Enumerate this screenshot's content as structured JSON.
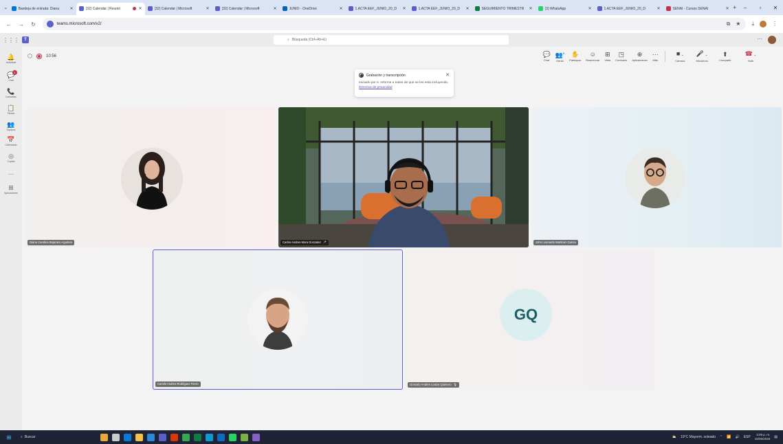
{
  "browser": {
    "tabs": [
      {
        "title": "Bandeja de entrada: Diana",
        "color": "#0078d4"
      },
      {
        "title": "(32) Calendar | Reunió",
        "color": "#5b5fc7",
        "active": true
      },
      {
        "title": "(32) Calendar | Microsoft",
        "color": "#5b5fc7"
      },
      {
        "title": "(32) Calendar | Microsoft",
        "color": "#5b5fc7"
      },
      {
        "title": "JUNIO - OneDrive",
        "color": "#0364b8"
      },
      {
        "title": "1.ACTA EEF_JUNIO_20_D",
        "color": "#5b5fc7"
      },
      {
        "title": "1.ACTA EEF_JUNIO_20_D",
        "color": "#5b5fc7"
      },
      {
        "title": "SEGUIMIENTO TRIMESTR",
        "color": "#107c41"
      },
      {
        "title": "(3) WhatsApp",
        "color": "#25d366"
      },
      {
        "title": "1.ACTA EEF_JUNIO_20_D",
        "color": "#5b5fc7"
      },
      {
        "title": "SENAI - Cursos SENAI",
        "color": "#c4314b"
      }
    ],
    "url": "teams.microsoft.com/v2/"
  },
  "teams": {
    "search_placeholder": "Búsqueda (Ctrl+Alt+E)",
    "rail": [
      {
        "label": "Actividad",
        "icon": "bell-icon",
        "glyph": "🔔"
      },
      {
        "label": "Chat",
        "icon": "chat-icon",
        "glyph": "💬",
        "badge": "1"
      },
      {
        "label": "Llamadas",
        "icon": "phone-icon",
        "glyph": "📞"
      },
      {
        "label": "Tareas",
        "icon": "tasks-icon",
        "glyph": "📋"
      },
      {
        "label": "Equipos",
        "icon": "teams-icon",
        "glyph": "👥"
      },
      {
        "label": "Calendario",
        "icon": "calendar-icon",
        "glyph": "📅"
      },
      {
        "label": "Copilot",
        "icon": "copilot-icon",
        "glyph": "◎"
      },
      {
        "label": "",
        "icon": "more-icon",
        "glyph": "···"
      },
      {
        "label": "Aplicaciones",
        "icon": "apps-icon",
        "glyph": "⊞"
      }
    ]
  },
  "meeting": {
    "timer": "10:56",
    "controls": [
      {
        "label": "Chat",
        "icon": "chat-icon",
        "glyph": "💬"
      },
      {
        "label": "Gente",
        "icon": "people-icon",
        "glyph": "👥",
        "count": "5"
      },
      {
        "label": "Participar",
        "icon": "raise-hand-icon",
        "glyph": "✋"
      },
      {
        "label": "Reaccionar",
        "icon": "react-icon",
        "glyph": "☺"
      },
      {
        "label": "Vista",
        "icon": "view-icon",
        "glyph": "⊞"
      },
      {
        "label": "Controles",
        "icon": "controls-icon",
        "glyph": "◳"
      },
      {
        "label": "Aplicaciones",
        "icon": "apps-icon",
        "glyph": "⊕"
      },
      {
        "label": "Más",
        "icon": "more-icon",
        "glyph": "···"
      }
    ],
    "media_controls": [
      {
        "label": "Cámara",
        "icon": "camera-icon",
        "glyph": "■"
      },
      {
        "label": "Micrófono",
        "icon": "mic-icon",
        "glyph": "🎤"
      },
      {
        "label": "Compartir",
        "icon": "share-icon",
        "glyph": "⬆"
      }
    ],
    "leave_label": "Salir",
    "toast": {
      "title": "Grabación y transcripción",
      "body": "Iniciado por ti. Informe a todos de que se les está incluyendo.",
      "link": "Directiva de privacidad"
    },
    "participants": [
      {
        "name": "Diana Carolina Bejarano Agudelo"
      },
      {
        "name": "Carlos Andres Mora Gonzalez"
      },
      {
        "name": "John Leonardo Martinez Garcia"
      },
      {
        "name": "Camilo Andres Rodriguez Fierro"
      },
      {
        "name": "Gonzalo Andres Loaiza Quintero",
        "initials": "GQ"
      }
    ]
  },
  "taskbar": {
    "search_label": "Buscar",
    "weather": "19°C  Mayorm. soleado",
    "lang": "ESP",
    "time": "3:09 p. m.",
    "date": "16/06/2026"
  }
}
